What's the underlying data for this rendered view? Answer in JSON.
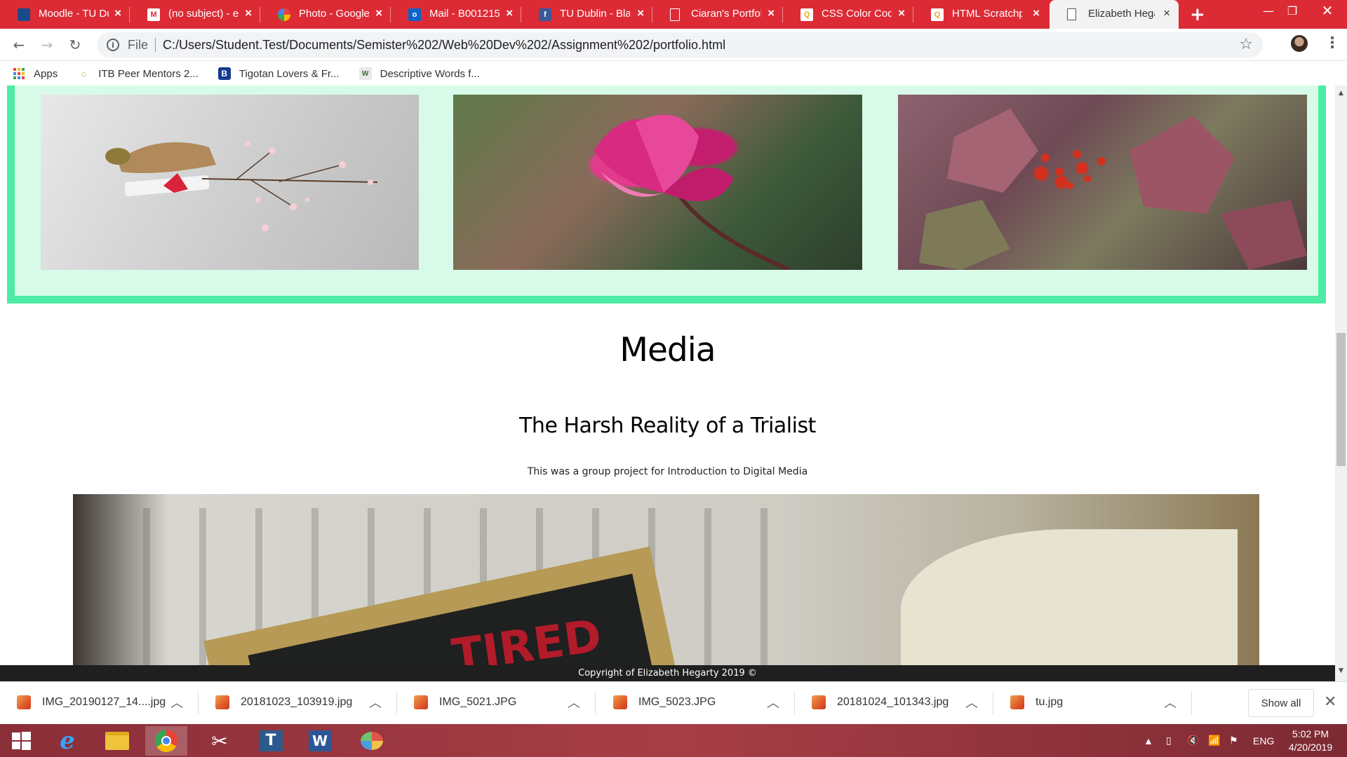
{
  "browser": {
    "tabs": [
      {
        "title": "Moodle - TU Du",
        "favicon": "moodle-icon",
        "color": "#1b4a8a"
      },
      {
        "title": "(no subject) - el",
        "favicon": "gmail-icon",
        "color": "#dd2b36"
      },
      {
        "title": "Photo - Google",
        "favicon": "google-photos-icon",
        "color": "#f4b400"
      },
      {
        "title": "Mail - B001215",
        "favicon": "outlook-icon",
        "color": "#0a64c8"
      },
      {
        "title": "TU Dublin - Blar",
        "favicon": "facebook-icon",
        "color": "#3b5998"
      },
      {
        "title": "Ciaran's Portfol",
        "favicon": "document-icon",
        "color": "#ffffff"
      },
      {
        "title": "CSS Color Code",
        "favicon": "w3schools-icon",
        "color": "#f5a623"
      },
      {
        "title": "HTML Scratchp",
        "favicon": "w3schools-icon",
        "color": "#f5a623"
      },
      {
        "title": "Elizabeth Hegar",
        "favicon": "document-icon",
        "color": "#ffffff"
      }
    ],
    "active_tab_index": 8,
    "new_tab_label": "+",
    "address": {
      "scheme_label": "File",
      "url": "C:/Users/Student.Test/Documents/Semister%202/Web%20Dev%202/Assignment%202/portfolio.html"
    },
    "bookmarks": [
      {
        "label": "Apps",
        "icon": "apps-grid-icon"
      },
      {
        "label": "ITB Peer Mentors 2...",
        "icon": "itb-icon"
      },
      {
        "label": "Tigotan Lovers & Fr...",
        "icon": "b-icon"
      },
      {
        "label": "Descriptive Words f...",
        "icon": "w-icon"
      }
    ]
  },
  "page": {
    "media_heading": "Media",
    "project_title": "The Harsh Reality of a Trialist",
    "project_description": "This was a group project for Introduction to Digital Media",
    "video_overlay_text": "TIRED",
    "footer": "Copyright of Elizabeth Hegarty 2019 ©",
    "colors": {
      "gallery_border": "#4deba4",
      "gallery_background": "#d8fbe9",
      "footer_background": "#1f1f1f"
    }
  },
  "downloads": {
    "items": [
      {
        "filename": "IMG_20190127_14....jpg"
      },
      {
        "filename": "20181023_103919.jpg"
      },
      {
        "filename": "IMG_5021.JPG"
      },
      {
        "filename": "IMG_5023.JPG"
      },
      {
        "filename": "20181024_101343.jpg"
      },
      {
        "filename": "tu.jpg"
      }
    ],
    "show_all_label": "Show all"
  },
  "taskbar": {
    "apps": [
      "windows-start-icon",
      "internet-explorer-icon",
      "file-explorer-icon",
      "chrome-icon",
      "snipping-tool-icon",
      "terminal-app-icon",
      "word-icon",
      "paint-icon"
    ],
    "language": "ENG",
    "time": "5:02 PM",
    "date": "4/20/2019"
  }
}
